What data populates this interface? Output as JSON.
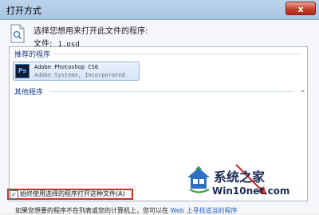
{
  "window": {
    "title": "打开方式",
    "close_label": "x"
  },
  "dialog": {
    "prompt": "选择您想用来打开此文件的程序:",
    "file_label": "文件:",
    "file_name": "1.psd"
  },
  "program_list": {
    "recommended_header": "推荐的程序",
    "other_header": "其他程序",
    "items": [
      {
        "name": "Adobe Photoshop CS6",
        "vendor": "Adobe Systems, Incorporated",
        "icon_text": "Ps"
      }
    ]
  },
  "options": {
    "always_use_label": "始终使用选择的程序打开这种文件(A)",
    "always_use_checked": true
  },
  "footer": {
    "text": "如果您想要的程序不在列表或您的计算机上，您可以在",
    "link_text": "Web 上寻找适当的程序"
  },
  "watermark": {
    "name": "系统之家",
    "url": "Win10net.com"
  },
  "colors": {
    "title_bar": "#b4cde9",
    "highlight_border": "#d22f2b",
    "list_selection": "#d9e8f8",
    "link": "#1f5ec7"
  }
}
